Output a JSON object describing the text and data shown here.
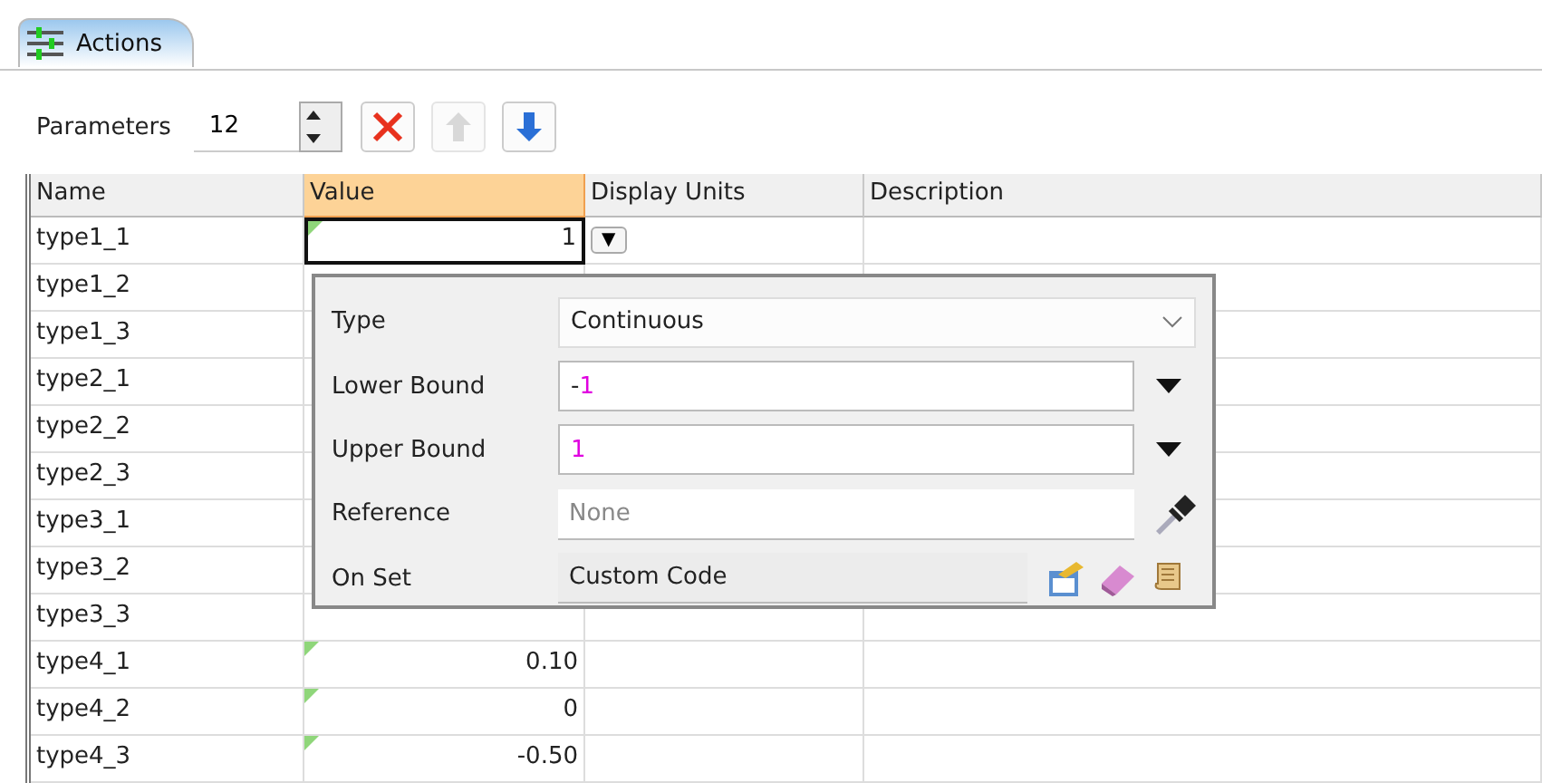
{
  "tab": {
    "label": "Actions",
    "selected": true
  },
  "parameters": {
    "label": "Parameters",
    "value": "12"
  },
  "toolbar": [
    {
      "kind": "delete",
      "disabled": false
    },
    {
      "kind": "up",
      "disabled": true
    },
    {
      "kind": "down",
      "disabled": false
    }
  ],
  "table": {
    "columns": [
      {
        "label": "Name",
        "selected": false
      },
      {
        "label": "Value",
        "selected": true
      },
      {
        "label": "Display Units",
        "selected": false
      },
      {
        "label": "Description",
        "selected": false
      }
    ],
    "rows": [
      {
        "name": "type1_1",
        "value": "1",
        "modified": true,
        "editing": true,
        "units_button": "▼"
      },
      {
        "name": "type1_2"
      },
      {
        "name": "type1_3"
      },
      {
        "name": "type2_1"
      },
      {
        "name": "type2_2"
      },
      {
        "name": "type2_3"
      },
      {
        "name": "type3_1"
      },
      {
        "name": "type3_2"
      },
      {
        "name": "type3_3"
      },
      {
        "name": "type4_1",
        "value": "0.10",
        "modified": true,
        "editing": false
      },
      {
        "name": "type4_2",
        "value": "0",
        "modified": true,
        "editing": false
      },
      {
        "name": "type4_3",
        "value": "-0.50",
        "modified": true,
        "editing": false
      }
    ]
  },
  "popup": {
    "fields": [
      {
        "kind": "combo",
        "label": "Type",
        "value": "Continuous"
      },
      {
        "kind": "expression",
        "label": "Lower Bound",
        "prefix": "-",
        "value": "1"
      },
      {
        "kind": "expression",
        "label": "Upper Bound",
        "value": "1"
      },
      {
        "kind": "reference",
        "label": "Reference",
        "placeholder": "None"
      },
      {
        "kind": "code",
        "label": "On Set",
        "value": "Custom Code"
      }
    ]
  }
}
